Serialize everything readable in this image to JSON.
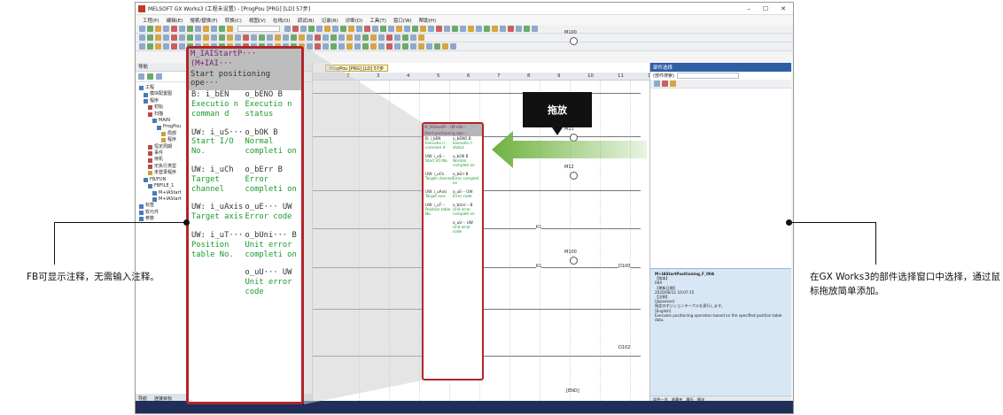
{
  "window": {
    "title": "MELSOFT GX Works3 (工程未设置) - [ProgPou [PRG] [LD] 57步]",
    "menu": [
      "工程(P)",
      "编辑(E)",
      "搜索/替换(F)",
      "转换(C)",
      "视图(V)",
      "在线(O)",
      "调试(B)",
      "记录(R)",
      "诊断(D)",
      "工具(T)",
      "窗口(W)",
      "帮助(H)"
    ]
  },
  "nav": {
    "header": "导航",
    "tree": [
      "工程",
      "模块配置图",
      "程序",
      "初始",
      "扫描",
      "MAIN",
      "ProgPou",
      "局部",
      "程序",
      "恒定周期",
      "事件",
      "待机",
      "无执行类型",
      "未登录程序",
      "FB/FUN",
      "FBFILE_1",
      "M+IAStart",
      "M+IAStart",
      "标签",
      "软元件",
      "参数"
    ],
    "footer": [
      "导航",
      "连接目标"
    ]
  },
  "editor": {
    "tab_label": "ProgPou [PRG] [LD] 57步",
    "ruler": [
      "2",
      "3",
      "4",
      "5",
      "6",
      "7",
      "8",
      "9",
      "10",
      "11",
      "12"
    ],
    "coils": [
      "M100",
      "M11",
      "M12",
      "M100"
    ],
    "devices": [
      "K1",
      "K1",
      "D100",
      "D102"
    ],
    "end_label": "END"
  },
  "parts": {
    "header": "部件选择",
    "search_label": "(部件搜索)",
    "info": [
      "M+IAStartPositioning_F_00A",
      "【版本】",
      "00A",
      "【更新日期】",
      "2020/06/11 10:07:15",
      "【注释】",
      "[Japanese]",
      "指定のポジションテーブルを実行します。",
      "[English]",
      "Executes positioning operation based on the specified position table data."
    ],
    "tabs": [
      "部件一览",
      "收藏夹",
      "履历",
      "模块"
    ]
  },
  "fb_small": {
    "title": "M_IAIStartP··· (M+IAI···",
    "subtitle": "Start positioning ope···",
    "rows": [
      {
        "l": "B: i_bEN",
        "r": "o_bENO  B"
      },
      {
        "l": "Executio n comman d",
        "r": "Executio n status",
        "comment": true
      },
      {
        "l": "UW: i_uS···",
        "r": "o_bOK  B"
      },
      {
        "l": "Start I/O No.",
        "r": "Normal completi on",
        "comment": true
      },
      {
        "l": "UW: i_uCh",
        "r": "o_bErr  B"
      },
      {
        "l": "Target channel",
        "r": "Error completi on",
        "comment": true
      },
      {
        "l": "UW: i_uAxis",
        "r": "o_uE···  UW"
      },
      {
        "l": "Target axis",
        "r": "Error code",
        "comment": true
      },
      {
        "l": "UW: i_uT···",
        "r": "o_bUni···  B"
      },
      {
        "l": "Position table No.",
        "r": "Unit error completi on",
        "comment": true
      },
      {
        "l": "",
        "r": "o_uU···  UW"
      },
      {
        "l": "",
        "r": "Unit error code",
        "comment": true
      }
    ]
  },
  "fb_zoom": {
    "title": "M_IAIStartP··· (M+IAI···",
    "subtitle": "Start positioning ope···",
    "rows": [
      {
        "l": "B: i_bEN",
        "r": "o_bENO  B"
      },
      {
        "l": "Executio n comman d",
        "r": "Executio n status",
        "comment": true
      },
      {
        "l": "UW: i_uS···",
        "r": "o_bOK  B"
      },
      {
        "l": "Start I/O No.",
        "r": "Normal completi on",
        "comment": true
      },
      {
        "l": "UW: i_uCh",
        "r": "o_bErr  B"
      },
      {
        "l": "Target channel",
        "r": "Error completi on",
        "comment": true
      },
      {
        "l": "UW: i_uAxis",
        "r": "o_uE···  UW"
      },
      {
        "l": "Target axis",
        "r": "Error code",
        "comment": true
      },
      {
        "l": "UW: i_uT···",
        "r": "o_bUni···  B"
      },
      {
        "l": "Position table No.",
        "r": "Unit error completi on",
        "comment": true
      },
      {
        "l": "",
        "r": "o_uU···  UW"
      },
      {
        "l": "",
        "r": "Unit error code",
        "comment": true
      }
    ]
  },
  "annotations": {
    "drag_label": "拖放",
    "left_note": "FB可显示注释，无需输入注释。",
    "right_note": "在GX Works3的部件选择窗口中选择，通过鼠标拖放简单添加。"
  },
  "colors": {
    "highlight": "#b1252a",
    "arrow": "#6fb23f",
    "comment": "#1a9a2a",
    "fb_name": "#7a1f74"
  }
}
